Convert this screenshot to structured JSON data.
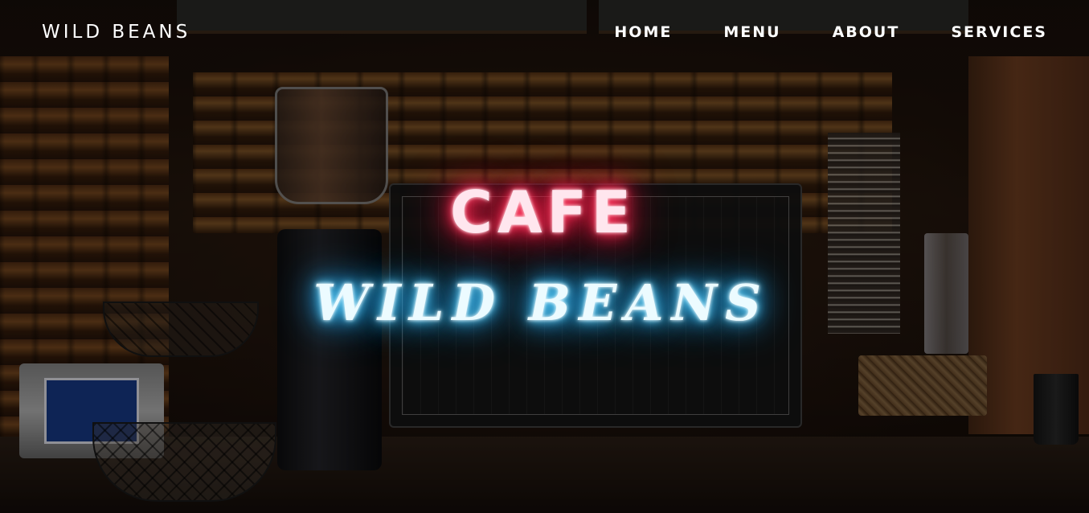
{
  "brand": {
    "logo_text": "WILD BEANS"
  },
  "nav": {
    "items": [
      {
        "label": "HOME"
      },
      {
        "label": "MENU"
      },
      {
        "label": "ABOUT"
      },
      {
        "label": "SERVICES"
      }
    ]
  },
  "hero": {
    "headline": "CAFE",
    "subheadline": "WILD BEANS",
    "headline_glow_color": "#ff1744",
    "subheadline_glow_color": "#1ea7ff",
    "background": "cafe-counter-photo"
  }
}
